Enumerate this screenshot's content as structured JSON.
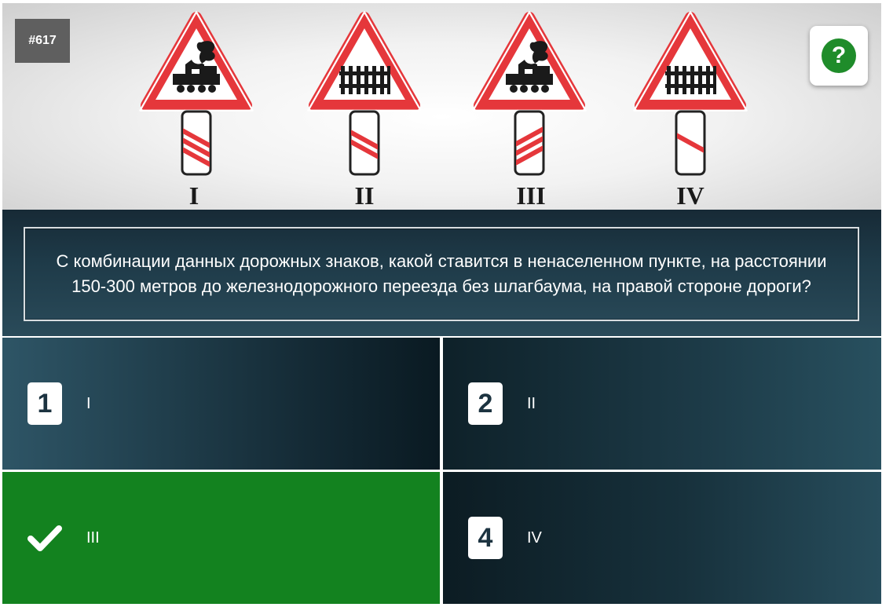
{
  "question": {
    "number_label": "#617",
    "text": "С комбинации данных дорожных знаков, какой ставится в ненаселенном пункте, на расстоянии 150-300 метров до железнодорожного переезда без шлагбаума, на правой стороне дороги?"
  },
  "help_button": {
    "label": "?",
    "icon": "question-mark-icon",
    "color": "#1f8c2a"
  },
  "signs": [
    {
      "label": "I",
      "triangle": "locomotive",
      "stripes": 3
    },
    {
      "label": "II",
      "triangle": "fence",
      "stripes": 2
    },
    {
      "label": "III",
      "triangle": "locomotive",
      "stripes": 3
    },
    {
      "label": "IV",
      "triangle": "fence",
      "stripes": 1
    }
  ],
  "answers": [
    {
      "number": "1",
      "label": "I",
      "state": "default"
    },
    {
      "number": "2",
      "label": "II",
      "state": "default"
    },
    {
      "number": "",
      "label": "III",
      "state": "correct",
      "icon": "checkmark-icon"
    },
    {
      "number": "4",
      "label": "IV",
      "state": "default"
    }
  ],
  "colors": {
    "correct": "#13821f",
    "sign_red": "#e03a3e",
    "question_bg": "#1e3a48"
  }
}
